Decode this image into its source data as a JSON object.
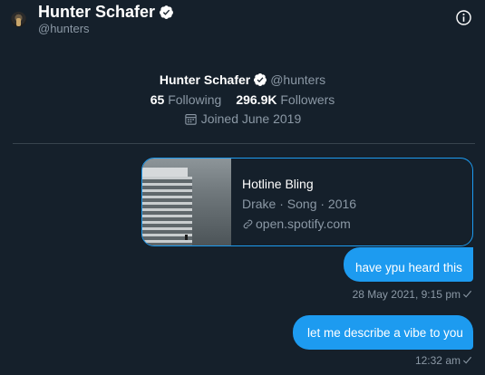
{
  "header": {
    "display_name": "Hunter Schafer",
    "handle": "@hunters",
    "avatar_icon": "avatar",
    "verified_icon": "verified-badge-icon",
    "info_icon": "info-icon"
  },
  "profile": {
    "display_name": "Hunter Schafer",
    "handle": "@hunters",
    "following_count": "65",
    "following_label": "Following",
    "followers_count": "296.9K",
    "followers_label": "Followers",
    "joined": "Joined June 2019",
    "calendar_icon": "calendar-icon"
  },
  "messages": [
    {
      "type": "card",
      "card": {
        "title": "Hotline Bling",
        "subtitle": "Drake · Song · 2016",
        "link": "open.spotify.com",
        "link_icon": "link-icon"
      }
    },
    {
      "type": "text",
      "text": "have ypu heard this",
      "timestamp": "28 May 2021, 9:15 pm"
    },
    {
      "type": "text",
      "text": "let me describe a vibe to you",
      "timestamp": "12:32 am"
    }
  ],
  "colors": {
    "background": "#15202b",
    "accent": "#1d9bf0",
    "secondary_text": "#8b98a5",
    "divider": "#38444d"
  }
}
